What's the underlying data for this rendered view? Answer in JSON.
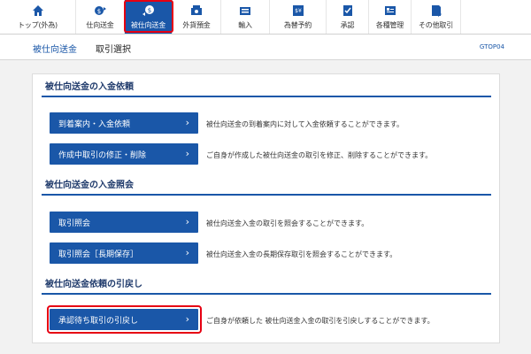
{
  "nav": {
    "items": [
      {
        "label": "トップ(外為)",
        "icon": "home-icon"
      },
      {
        "label": "仕向送金",
        "icon": "outward-remittance-icon"
      },
      {
        "label": "被仕向送金",
        "icon": "inward-remittance-icon"
      },
      {
        "label": "外貨預金",
        "icon": "foreign-deposit-icon"
      },
      {
        "label": "輸入",
        "icon": "import-icon"
      },
      {
        "label": "為替予約",
        "icon": "exchange-contract-icon"
      },
      {
        "label": "承認",
        "icon": "approval-icon"
      },
      {
        "label": "各種管理",
        "icon": "management-icon"
      },
      {
        "label": "その他取引",
        "icon": "other-transactions-icon"
      }
    ],
    "active_label": "被仕向送金"
  },
  "subheader": {
    "section": "被仕向送金",
    "page": "取引選択",
    "code": "GTOP04"
  },
  "sections": [
    {
      "title": "被仕向送金の入金依頼",
      "rows": [
        {
          "button": "到着案内・入金依頼",
          "description": "被仕向送金の到着案内に対して入金依頼することができます。"
        },
        {
          "button": "作成中取引の修正・削除",
          "description": "ご自身が作成した被仕向送金の取引を修正、削除することができます。"
        }
      ]
    },
    {
      "title": "被仕向送金の入金照会",
      "rows": [
        {
          "button": "取引照会",
          "description": "被仕向送金入金の取引を照会することができます。"
        },
        {
          "button": "取引照会［長期保存］",
          "description": "被仕向送金入金の長期保存取引を照会することができます。"
        }
      ]
    },
    {
      "title": "被仕向送金依頼の引戻し",
      "rows": [
        {
          "button": "承認待ち取引の引戻し",
          "description": "ご自身が依頼した 被仕向送金入金の取引を引戻しすることができます。"
        }
      ]
    }
  ],
  "arrow": "›",
  "colors": {
    "accent": "#1a57a8",
    "highlight_frame": "#e60012",
    "background": "#f2f2f2"
  }
}
